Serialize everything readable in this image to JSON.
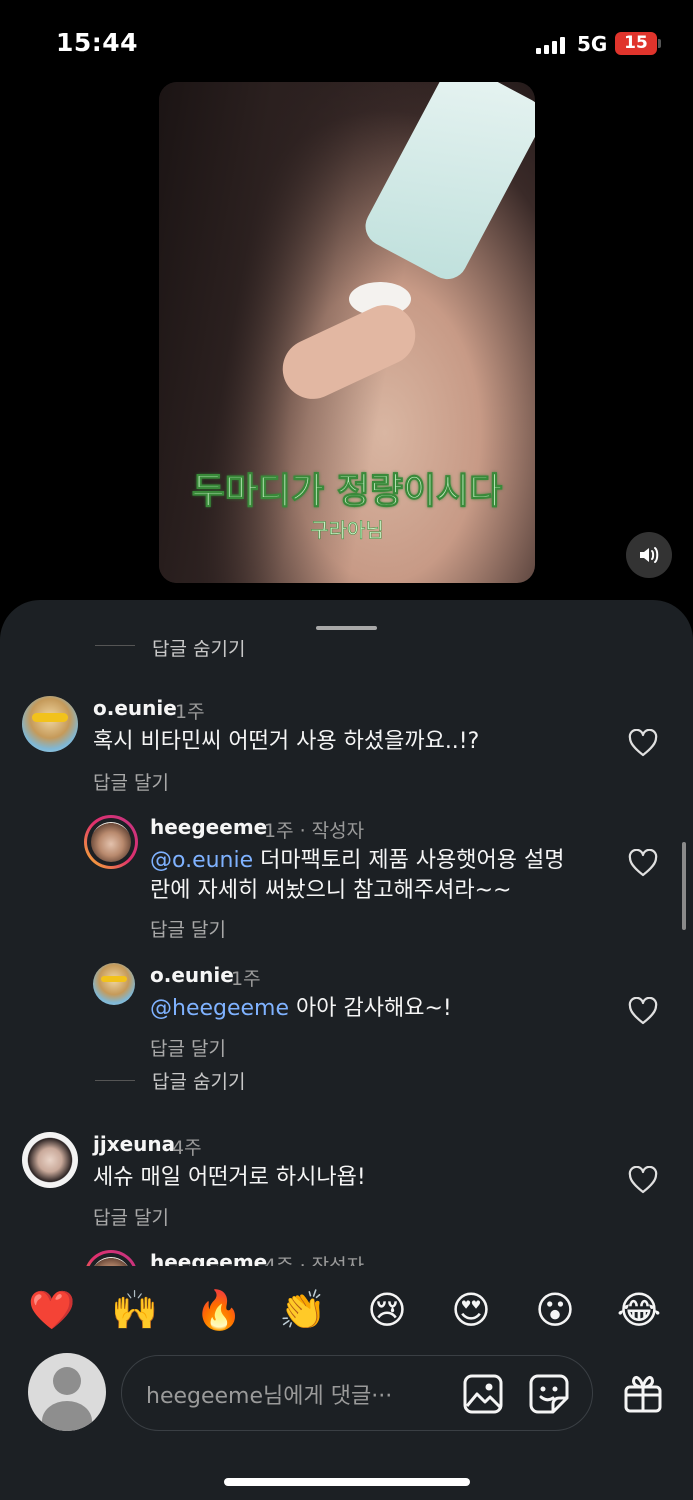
{
  "status_bar": {
    "time": "15:44",
    "network": "5G",
    "battery": "15"
  },
  "video": {
    "caption_main": "두마디가 정량이시다",
    "caption_sub": "구라아님"
  },
  "comments": {
    "hidden_reply_label_top": "답글 숨기기",
    "items": [
      {
        "username": "o.eunie",
        "time": "1주",
        "text": "혹시 비타민씨 어떤거 사용 하셨을까요..!?",
        "reply_label": "답글 달기"
      },
      {
        "username": "heegeeme",
        "time": "1주 · 작성자",
        "mention": "@o.eunie",
        "text_line1": " 더마팩토리 제품 사용햇어용 설명",
        "text_line2": "란에 자세히 써놨으니 참고해주셔라~~",
        "reply_label": "답글 달기"
      },
      {
        "username": "o.eunie",
        "time": "1주",
        "mention": "@heegeeme",
        "text": " 아아 감사해요~!",
        "reply_label": "답글 달기"
      },
      {
        "username": "jjxeuna",
        "time": "4주",
        "text": "세슈 매일 어떤거로 하시나욥!",
        "reply_label": "답글 달기"
      },
      {
        "username": "heegeeme",
        "time": "4주 · 작성자"
      }
    ],
    "hide_replies_label": "답글 숨기기"
  },
  "reactions": [
    "❤️",
    "🙌",
    "🔥",
    "👏",
    "😢",
    "😍",
    "😮",
    "😂"
  ],
  "input": {
    "placeholder": "heegeeme님에게 댓글···"
  }
}
